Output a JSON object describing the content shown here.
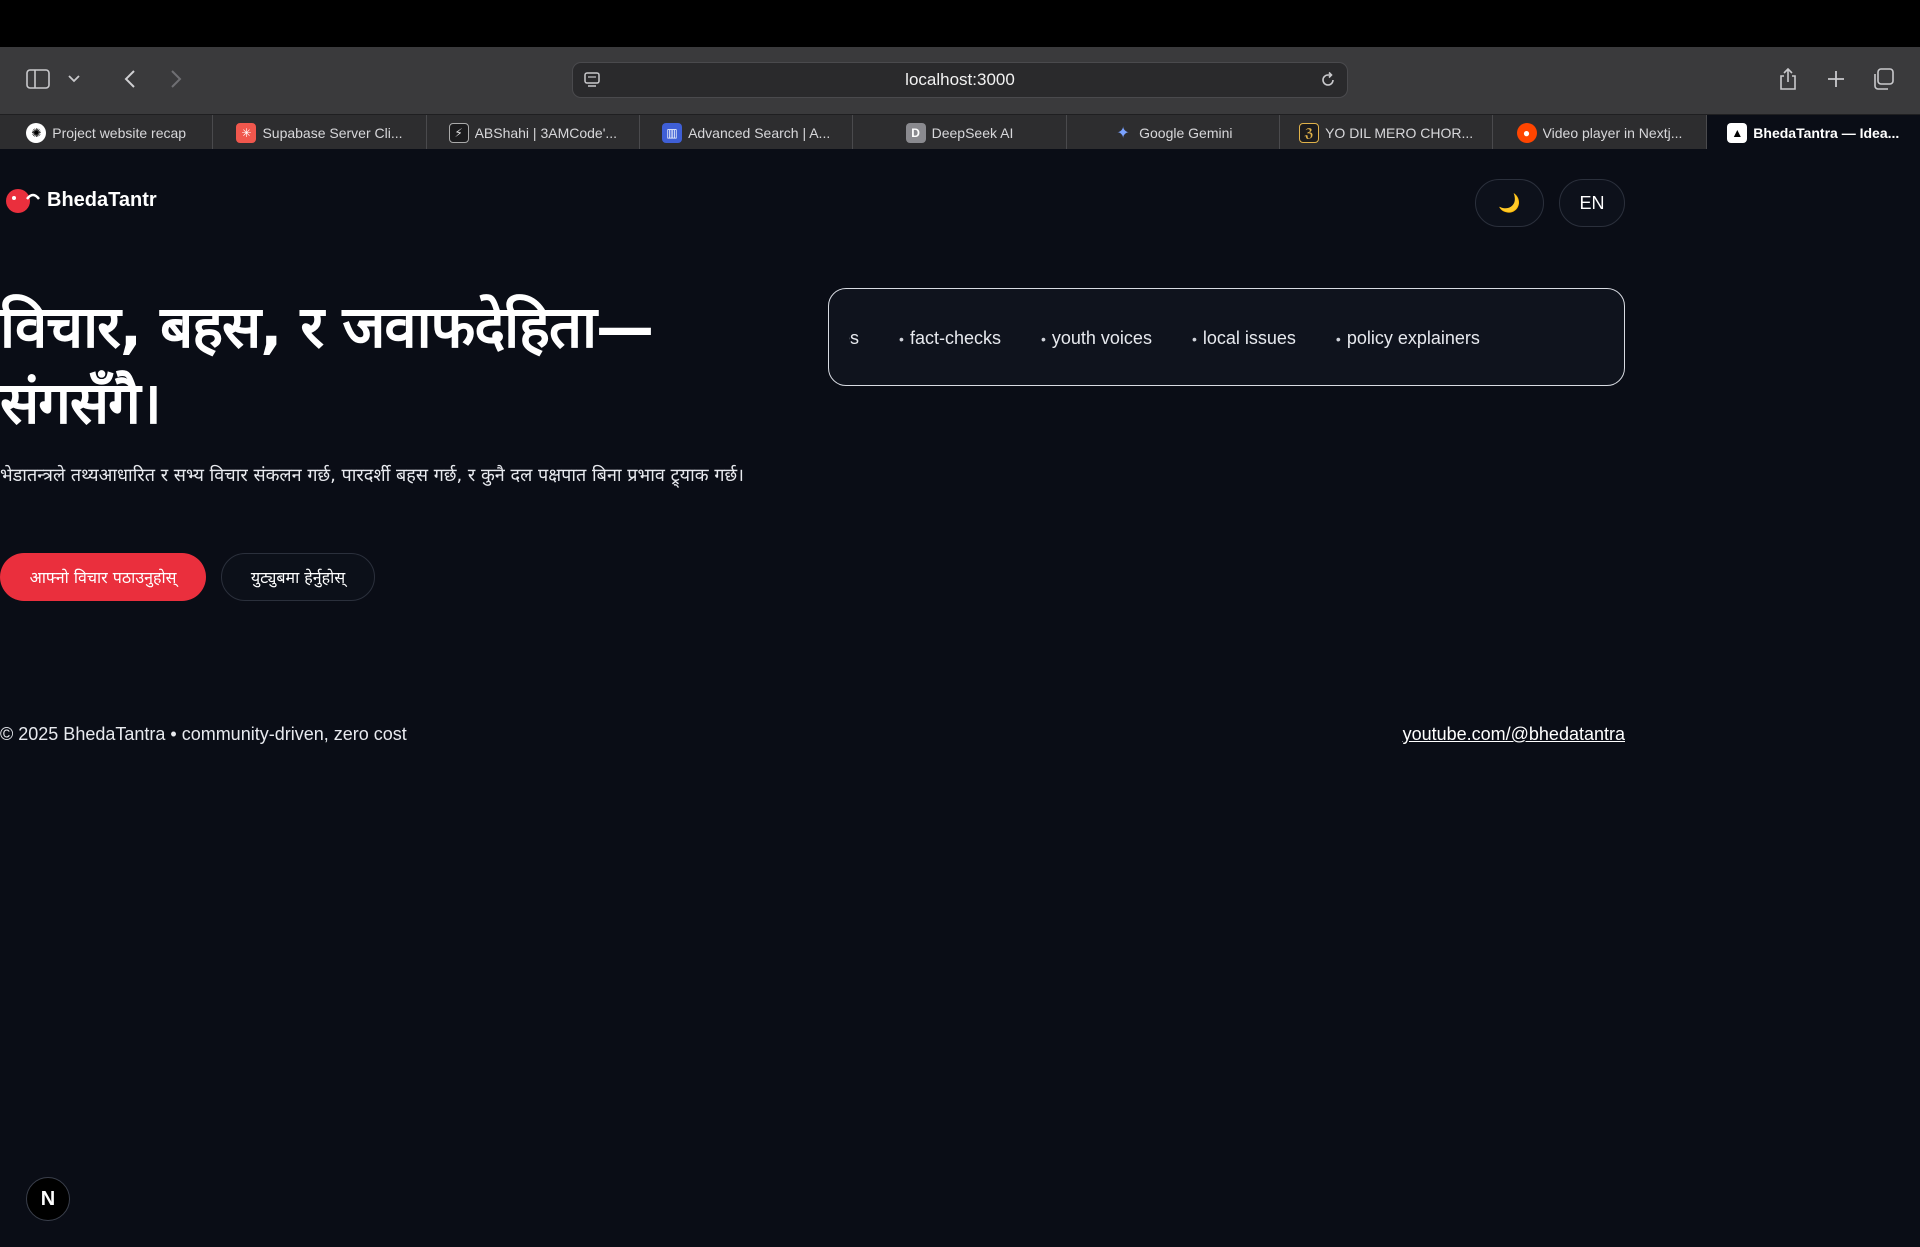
{
  "browser": {
    "url": "localhost:3000",
    "tabs": [
      {
        "label": "Project website recap",
        "icon": "openai-icon"
      },
      {
        "label": "Supabase Server Cli...",
        "icon": "supabase-icon"
      },
      {
        "label": "ABShahi | 3AMCode'...",
        "icon": "bolt-icon"
      },
      {
        "label": "Advanced Search | A...",
        "icon": "search-chart-icon"
      },
      {
        "label": "DeepSeek AI",
        "icon": "deepseek-icon"
      },
      {
        "label": "Google Gemini",
        "icon": "gemini-icon"
      },
      {
        "label": "YO DIL MERO CHOR...",
        "icon": "music-icon"
      },
      {
        "label": "Video player in Nextj...",
        "icon": "reddit-icon"
      },
      {
        "label": "BhedaTantra — Idea...",
        "icon": "vercel-icon",
        "active": true
      }
    ]
  },
  "header": {
    "brand": "BhedaTantr",
    "theme_toggle": "🌙",
    "language": "EN"
  },
  "hero": {
    "headline_line1": "विचार, बहस, र जवाफदेहिता—",
    "headline_line2": "संगसँगै।",
    "subtext": "भेडातन्त्रले तथ्यआधारित र सभ्य विचार संकलन गर्छ, पारदर्शी बहस गर्छ, र कुनै दल पक्षपात बिना प्रभाव ट्र्याक गर्छ।",
    "cta_primary": "आफ्नो विचार पठाउनुहोस्",
    "cta_secondary": "युट्युबमा हेर्नुहोस्"
  },
  "ticker": {
    "items": [
      "pates",
      "fact-checks",
      "youth voices",
      "local issues",
      "policy explainers"
    ]
  },
  "footer": {
    "copyright": "© 2025 BhedaTantra • community-driven, zero cost",
    "link": "youtube.com/@bhedatantra"
  },
  "dev_badge": "N",
  "colors": {
    "background": "#0a0d16",
    "accent": "#ea2f3d"
  }
}
